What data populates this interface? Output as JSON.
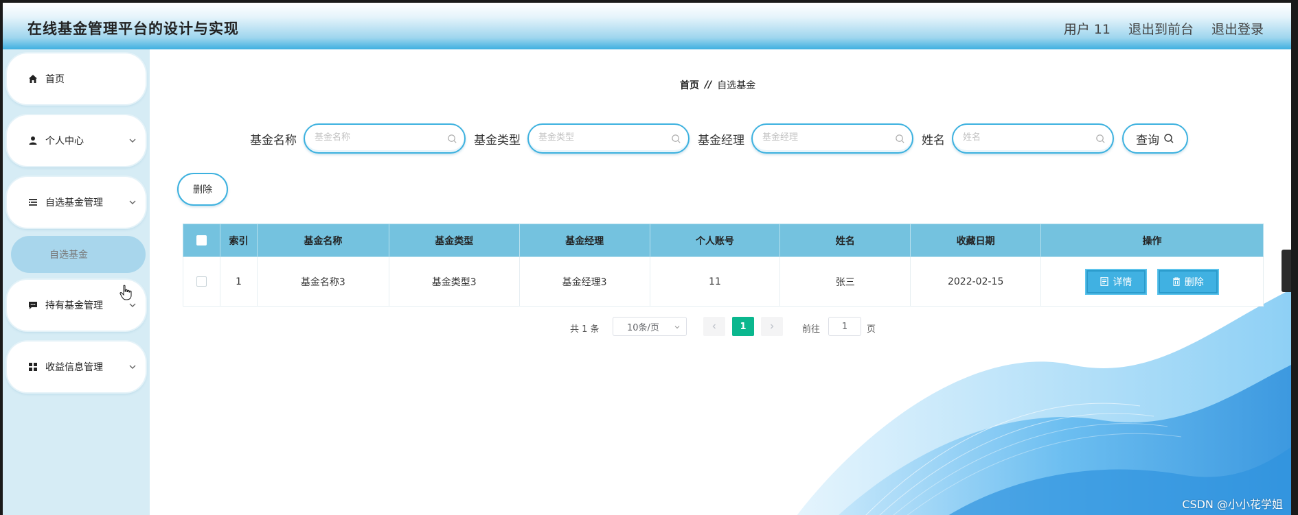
{
  "header": {
    "title": "在线基金管理平台的设计与实现",
    "user": "用户 11",
    "to_front": "退出到前台",
    "logout": "退出登录"
  },
  "sidebar": {
    "items": [
      {
        "label": "首页",
        "icon": "home-icon"
      },
      {
        "label": "个人中心",
        "icon": "user-icon"
      },
      {
        "label": "自选基金管理",
        "icon": "list-icon"
      },
      {
        "label": "持有基金管理",
        "icon": "chat-icon"
      },
      {
        "label": "收益信息管理",
        "icon": "grid-icon"
      }
    ],
    "sub_active": "自选基金"
  },
  "breadcrumb": {
    "home": "首页",
    "sep": "//",
    "current": "自选基金"
  },
  "search": {
    "fields": [
      {
        "label": "基金名称",
        "placeholder": "基金名称"
      },
      {
        "label": "基金类型",
        "placeholder": "基金类型"
      },
      {
        "label": "基金经理",
        "placeholder": "基金经理"
      },
      {
        "label": "姓名",
        "placeholder": "姓名"
      }
    ],
    "query_label": "查询"
  },
  "toolbar": {
    "delete_label": "删除"
  },
  "table": {
    "columns": [
      "索引",
      "基金名称",
      "基金类型",
      "基金经理",
      "个人账号",
      "姓名",
      "收藏日期",
      "操作"
    ],
    "rows": [
      {
        "index": "1",
        "fund_name": "基金名称3",
        "fund_type": "基金类型3",
        "manager": "基金经理3",
        "account": "11",
        "name": "张三",
        "date": "2022-02-15"
      }
    ],
    "detail_label": "详情",
    "row_delete_label": "删除"
  },
  "pagination": {
    "total": "共 1 条",
    "page_size": "10条/页",
    "current_page": "1",
    "goto_prefix": "前往",
    "goto_value": "1",
    "goto_suffix": "页"
  },
  "watermark": "CSDN @小小花学姐",
  "colors": {
    "accent": "#40b1e2",
    "header_bg": "#74c2df",
    "page_active": "#0ab78e",
    "sidebar_bg": "#d6ecf5"
  }
}
